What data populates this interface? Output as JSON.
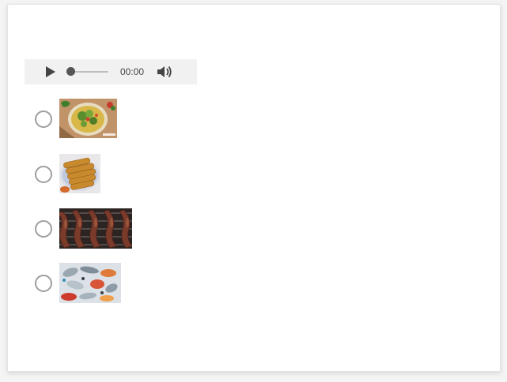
{
  "player": {
    "time": "00:00",
    "progress": 0,
    "icons": {
      "play": "play-icon",
      "volume": "volume-icon"
    }
  },
  "options": [
    {
      "image": "salad-bowl-image",
      "selected": false
    },
    {
      "image": "fried-rolls-image",
      "selected": false
    },
    {
      "image": "grilled-sausages-image",
      "selected": false
    },
    {
      "image": "seafood-platter-image",
      "selected": false
    }
  ],
  "colors": {
    "player_bg": "#f1f1f1",
    "radio_border": "#9e9e9e",
    "card_bg": "#ffffff"
  }
}
